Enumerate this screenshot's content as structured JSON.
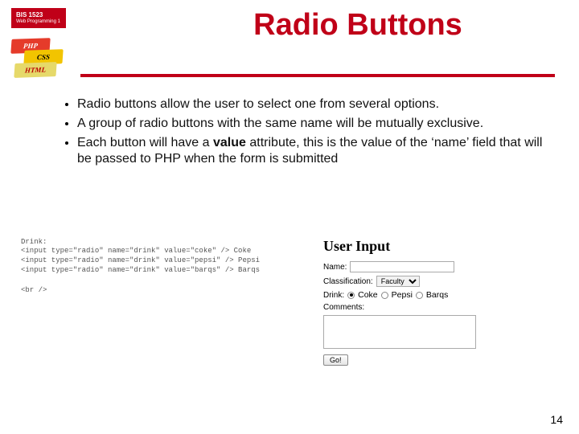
{
  "header": {
    "course_code": "BIS 1523",
    "course_name": "Web Programming 1",
    "title": "Radio Buttons",
    "brick_php": "PHP",
    "brick_css": "CSS",
    "brick_html": "HTML"
  },
  "bullets": {
    "b1": "Radio buttons allow the user to select one from several options.",
    "b2": "A group of radio buttons with the same name will be mutually exclusive.",
    "b3a": "Each button will have a ",
    "b3_bold": "value",
    "b3b": " attribute, this is the value of the ‘name’ field that will be passed to PHP when the form is submitted"
  },
  "code_panel": {
    "label": "Drink:",
    "lines": "<input type=\"radio\" name=\"drink\" value=\"coke\" /> Coke\n<input type=\"radio\" name=\"drink\" value=\"pepsi\" /> Pepsi\n<input type=\"radio\" name=\"drink\" value=\"barqs\" /> Barqs\n\n<br />"
  },
  "form_panel": {
    "title": "User Input",
    "name_label": "Name:",
    "name_value": "",
    "class_label": "Classification:",
    "class_value": "Faculty",
    "drink_label": "Drink:",
    "options": {
      "coke": "Coke",
      "pepsi": "Pepsi",
      "barqs": "Barqs"
    },
    "comments_label": "Comments:",
    "comments_value": "",
    "submit_label": "Go!"
  },
  "page_number": "14"
}
